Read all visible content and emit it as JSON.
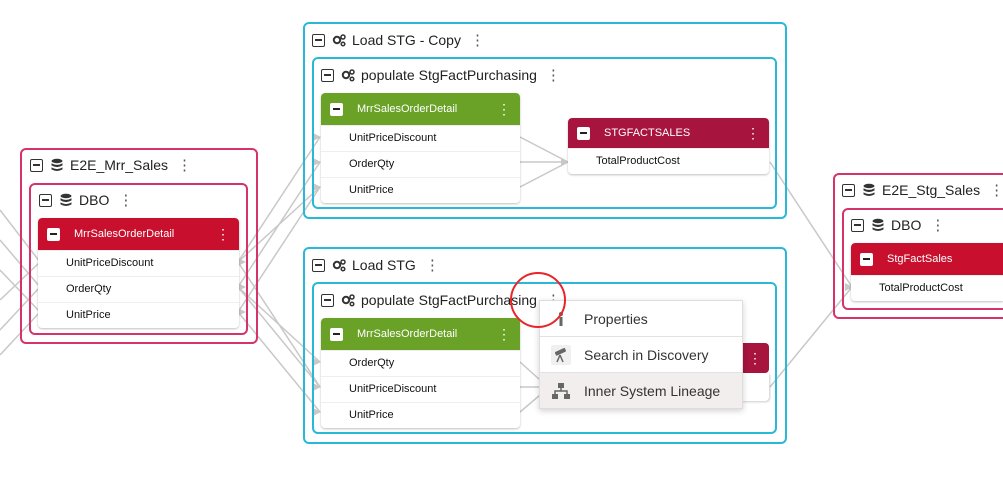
{
  "left_db": {
    "title": "E2E_Mrr_Sales",
    "schema": "DBO",
    "table": {
      "name": "MrrSalesOrderDetail",
      "columns": [
        "UnitPriceDiscount",
        "OrderQty",
        "UnitPrice"
      ]
    }
  },
  "top_pkg": {
    "title": "Load STG - Copy",
    "task": "populate StgFactPurchasing",
    "source": {
      "name": "MrrSalesOrderDetail",
      "columns": [
        "UnitPriceDiscount",
        "OrderQty",
        "UnitPrice"
      ]
    },
    "target": {
      "name": "STGFACTSALES",
      "columns": [
        "TotalProductCost"
      ]
    }
  },
  "bottom_pkg": {
    "title": "Load STG",
    "task": "populate StgFactPurchasing",
    "source": {
      "name": "MrrSalesOrderDetail",
      "columns": [
        "OrderQty",
        "UnitPriceDiscount",
        "UnitPrice"
      ]
    }
  },
  "right_db": {
    "title": "E2E_Stg_Sales",
    "schema": "DBO",
    "table": {
      "name": "StgFactSales",
      "columns": [
        "TotalProductCost"
      ]
    }
  },
  "context_menu": {
    "items": [
      {
        "label": "Properties",
        "icon": "properties-icon"
      },
      {
        "label": "Search in Discovery",
        "icon": "telescope-icon"
      },
      {
        "label": "Inner System Lineage",
        "icon": "hierarchy-icon"
      }
    ],
    "highlighted_index": 2
  },
  "kebab": "⋮",
  "colors": {
    "pink_border": "#d6336c",
    "cyan_border": "#29b8d8",
    "green_header": "#6aa127",
    "red_header": "#c8102e",
    "wine_header": "#a7143e",
    "annotation_circle": "#e8262a"
  }
}
